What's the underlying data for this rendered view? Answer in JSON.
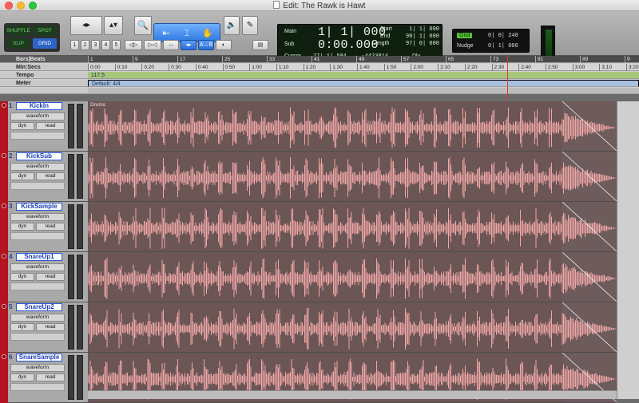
{
  "window": {
    "title": "Edit: The Rawk is Hawt"
  },
  "modes": {
    "shuffle": "SHUFFLE",
    "spot": "SPOT",
    "slip": "SLIP",
    "grid": "GRID"
  },
  "toolbar": {
    "numbers": [
      "1",
      "2",
      "3",
      "4",
      "5"
    ],
    "row2_labels": [
      "◁▷",
      "▷◁",
      "↔",
      "◂▸",
      "A↔B",
      "◐",
      "▤"
    ]
  },
  "counter": {
    "main_label": "Main",
    "main_value": "1| 1| 000",
    "sub_label": "Sub",
    "sub_value": "0:00.000",
    "start_label": "Start",
    "start_value": "1| 1| 000",
    "end_label": "End",
    "end_value": "98| 1| 000",
    "length_label": "Length",
    "length_value": "97| 0| 000",
    "cursor_label": "Cursor",
    "cursor_value": "77| 1| 584",
    "cursor_sample": "-4423814",
    "dly_label": "Dly"
  },
  "grid": {
    "grid_label": "Grid",
    "grid_value": "0| 0| 240",
    "nudge_label": "Nudge",
    "nudge_value": "0| 1| 000"
  },
  "rulers": {
    "bars_label": "Bars|Beats",
    "minsecs_label": "Min:Secs",
    "tempo_label": "Tempo",
    "meter_label": "Meter",
    "tempo_value": "117.5",
    "meter_value": "Default: 4/4",
    "bars_ticks": [
      "1",
      "9",
      "17",
      "25",
      "33",
      "41",
      "49",
      "57",
      "65",
      "73",
      "81",
      "89",
      "9"
    ],
    "time_ticks": [
      "0:00",
      "0:10",
      "0:20",
      "0:30",
      "0:40",
      "0:50",
      "1:00",
      "1:10",
      "1:20",
      "1:30",
      "1:40",
      "1:50",
      "2:00",
      "2:10",
      "2:20",
      "2:30",
      "2:40",
      "2:50",
      "3:00",
      "3:10",
      "3:20"
    ]
  },
  "tracks": [
    {
      "num": "1",
      "name": "KickIn",
      "view": "waveform",
      "dyn": "dyn",
      "auto": "read",
      "clip": "Drums"
    },
    {
      "num": "2",
      "name": "KickSub",
      "view": "waveform",
      "dyn": "dyn",
      "auto": "read",
      "clip": ""
    },
    {
      "num": "3",
      "name": "KickSample",
      "view": "waveform",
      "dyn": "dyn",
      "auto": "read",
      "clip": ""
    },
    {
      "num": "4",
      "name": "SnareUp1",
      "view": "waveform",
      "dyn": "dyn",
      "auto": "read",
      "clip": ""
    },
    {
      "num": "5",
      "name": "SnareUp2",
      "view": "waveform",
      "dyn": "dyn",
      "auto": "read",
      "clip": ""
    },
    {
      "num": "6",
      "name": "SnareSample",
      "view": "waveform",
      "dyn": "dyn",
      "auto": "read",
      "clip": ""
    }
  ],
  "colors": {
    "waveform": "#f0a7a7",
    "track_red": "#b3141f",
    "clip_bg": "#6b5555"
  }
}
